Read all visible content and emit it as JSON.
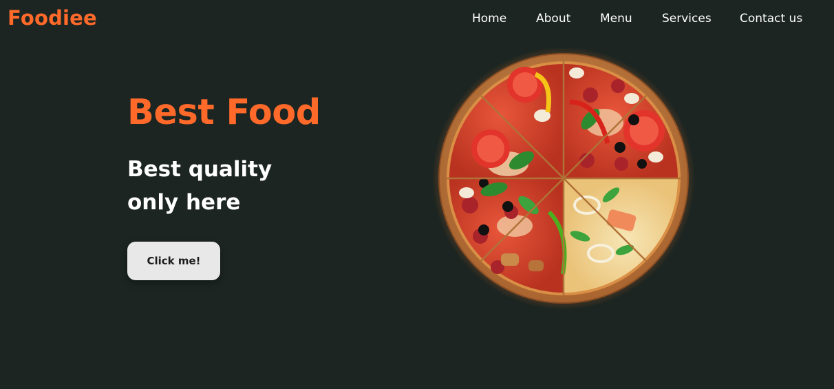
{
  "brand": {
    "logo_text": "Foodiee",
    "accent_color": "#ff6a2b",
    "background_color": "#1c2521"
  },
  "nav": {
    "items": [
      {
        "label": "Home"
      },
      {
        "label": "About"
      },
      {
        "label": "Menu"
      },
      {
        "label": "Services"
      },
      {
        "label": "Contact us"
      }
    ]
  },
  "hero": {
    "title": "Best Food",
    "subtitle": "Best quality only here",
    "button_label": "Click me!"
  },
  "image": {
    "subject": "pizza-image"
  }
}
